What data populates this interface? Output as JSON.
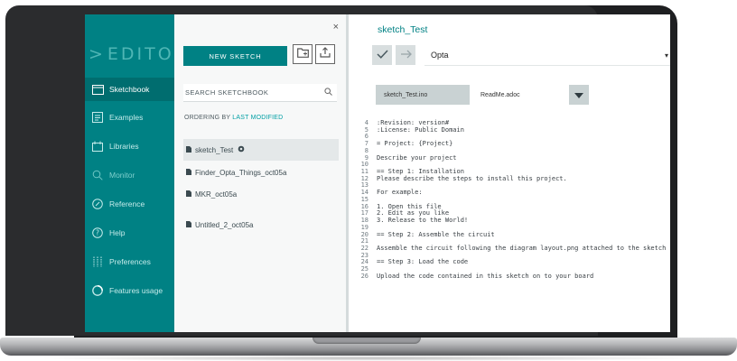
{
  "nav": {
    "logo": "EDITOR",
    "items": [
      {
        "label": "Sketchbook",
        "icon": "folder-icon"
      },
      {
        "label": "Examples",
        "icon": "examples-icon"
      },
      {
        "label": "Libraries",
        "icon": "library-icon"
      },
      {
        "label": "Monitor",
        "icon": "search-icon"
      },
      {
        "label": "Reference",
        "icon": "compass-icon"
      },
      {
        "label": "Help",
        "icon": "help-icon"
      },
      {
        "label": "Preferences",
        "icon": "sliders-icon"
      },
      {
        "label": "Features usage",
        "icon": "pie-icon"
      }
    ]
  },
  "panel": {
    "close": "×",
    "new_sketch": "NEW SKETCH",
    "search_label": "SEARCH SKETCHBOOK",
    "ordering_prefix": "ORDERING BY",
    "ordering_value": "LAST MODIFIED",
    "sketches": [
      {
        "name": "sketch_Test"
      },
      {
        "name": "Finder_Opta_Things_oct05a"
      },
      {
        "name": "MKR_oct05a"
      },
      {
        "name": "Untitled_2_oct05a"
      }
    ]
  },
  "editor": {
    "title": "sketch_Test",
    "board": "Opta",
    "tabs": [
      "sketch_Test.ino",
      "ReadMe.adoc"
    ],
    "lines": [
      {
        "n": "4",
        "t": ":Revision: version#"
      },
      {
        "n": "5",
        "t": ":License: Public Domain"
      },
      {
        "n": "6",
        "t": ""
      },
      {
        "n": "7",
        "t": "= Project: {Project}"
      },
      {
        "n": "8",
        "t": ""
      },
      {
        "n": "9",
        "t": "Describe your project"
      },
      {
        "n": "10",
        "t": ""
      },
      {
        "n": "11",
        "t": "== Step 1: Installation"
      },
      {
        "n": "12",
        "t": "Please describe the steps to install this project."
      },
      {
        "n": "13",
        "t": ""
      },
      {
        "n": "14",
        "t": "For example:"
      },
      {
        "n": "15",
        "t": ""
      },
      {
        "n": "16",
        "t": "1. Open this file"
      },
      {
        "n": "17",
        "t": "2. Edit as you like"
      },
      {
        "n": "18",
        "t": "3. Release to the World!"
      },
      {
        "n": "19",
        "t": ""
      },
      {
        "n": "20",
        "t": "== Step 2: Assemble the circuit"
      },
      {
        "n": "21",
        "t": ""
      },
      {
        "n": "22",
        "t": "Assemble the circuit following the diagram layout.png attached to the sketch"
      },
      {
        "n": "23",
        "t": ""
      },
      {
        "n": "24",
        "t": "== Step 3: Load the code"
      },
      {
        "n": "25",
        "t": ""
      },
      {
        "n": "26",
        "t": "Upload the code contained in this sketch on to your board"
      }
    ]
  },
  "colors": {
    "accent": "#008184",
    "nav_active": "#006d6f",
    "link": "#009fa4"
  }
}
